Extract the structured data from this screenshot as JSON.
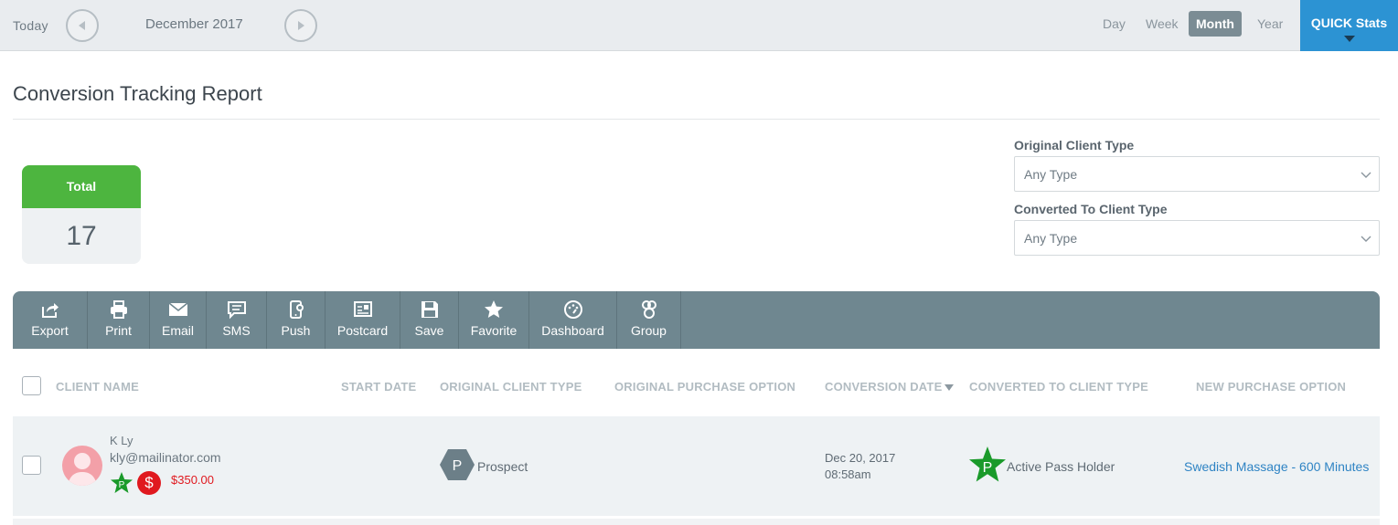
{
  "topbar": {
    "today": "Today",
    "current_period": "December 2017",
    "views": [
      "Day",
      "Week",
      "Month",
      "Year"
    ],
    "active_view": "Month",
    "quick_stats": "QUICK Stats"
  },
  "page": {
    "title": "Conversion Tracking Report"
  },
  "total_card": {
    "label": "Total",
    "value": "17"
  },
  "filters": {
    "original": {
      "label": "Original Client Type",
      "value": "Any Type"
    },
    "converted": {
      "label": "Converted To Client Type",
      "value": "Any Type"
    }
  },
  "toolbar": [
    "Export",
    "Print",
    "Email",
    "SMS",
    "Push",
    "Postcard",
    "Save",
    "Favorite",
    "Dashboard",
    "Group"
  ],
  "table": {
    "headers": {
      "client_name": "CLIENT NAME",
      "start_date": "START DATE",
      "original_client_type": "ORIGINAL CLIENT TYPE",
      "original_purchase_option": "ORIGINAL PURCHASE OPTION",
      "conversion_date": "CONVERSION DATE",
      "converted_to_client_type": "CONVERTED TO CLIENT TYPE",
      "new_purchase_option": "NEW PURCHASE OPTION"
    },
    "rows": [
      {
        "name": "K Ly",
        "email": "kly@mailinator.com",
        "badge_letter": "P",
        "amount": "$350.00",
        "start_date": "",
        "original_type_letter": "P",
        "original_type": "Prospect",
        "original_purchase": "",
        "conversion_date": "Dec 20, 2017",
        "conversion_time": "08:58am",
        "converted_type_letter": "P",
        "converted_type": "Active Pass Holder",
        "new_purchase": "Swedish Massage - 600 Minutes"
      }
    ]
  },
  "colors": {
    "topbar_bg": "#e9ecef",
    "quick_stats_bg": "#2c93d3",
    "total_header": "#4db53f",
    "toolbar_bg": "#6f8790",
    "star_green": "#1a9a2a",
    "dollar_red": "#e0191f",
    "link_blue": "#2f84c4"
  }
}
